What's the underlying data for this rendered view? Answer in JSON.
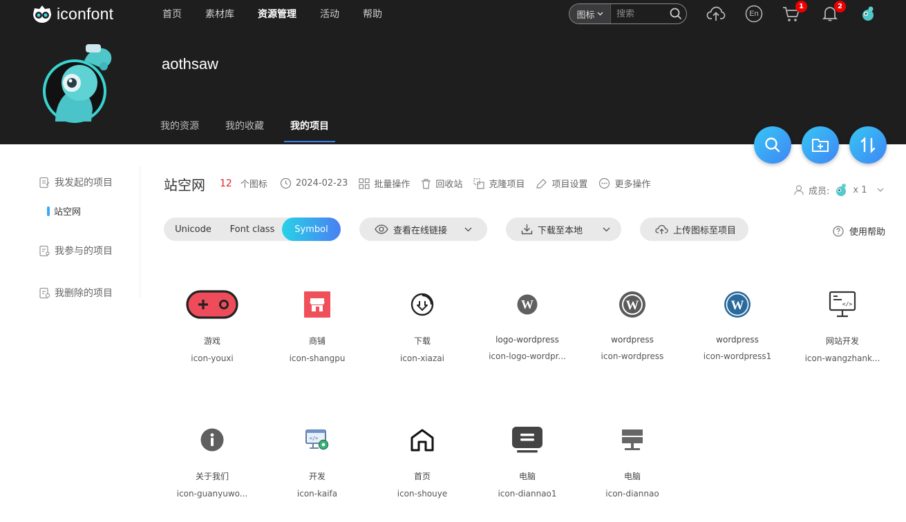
{
  "header": {
    "logo_text": "iconfont",
    "nav": [
      {
        "label": "首页",
        "active": false
      },
      {
        "label": "素材库",
        "active": false
      },
      {
        "label": "资源管理",
        "active": true
      },
      {
        "label": "活动",
        "active": false
      },
      {
        "label": "帮助",
        "active": false
      }
    ],
    "search": {
      "type_label": "图标",
      "placeholder": "搜索"
    },
    "cart_badge": "1",
    "notification_badge": "2",
    "lang_label": "En"
  },
  "profile": {
    "username": "aothsaw",
    "tabs": [
      {
        "label": "我的资源",
        "active": false
      },
      {
        "label": "我的收藏",
        "active": false
      },
      {
        "label": "我的项目",
        "active": true
      }
    ]
  },
  "sidebar": {
    "created_label": "我发起的项目",
    "created_projects": [
      "站空网"
    ],
    "joined_label": "我参与的项目",
    "deleted_label": "我删除的项目"
  },
  "project": {
    "name": "站空网",
    "icon_count": "12",
    "icon_count_suffix": "个图标",
    "date": "2024-02-23",
    "actions": [
      "批量操作",
      "回收站",
      "克隆项目",
      "项目设置",
      "更多操作"
    ],
    "members_label": "成员:",
    "members_count": "x 1"
  },
  "toolbar": {
    "segments": [
      {
        "label": "Unicode",
        "active": false
      },
      {
        "label": "Font class",
        "active": false
      },
      {
        "label": "Symbol",
        "active": true
      }
    ],
    "view_online": "查看在线链接",
    "download": "下载至本地",
    "upload": "上传图标至项目",
    "help": "使用帮助"
  },
  "icons": [
    {
      "name": "游戏",
      "code": "icon-youxi",
      "glyph": "gamepad"
    },
    {
      "name": "商铺",
      "code": "icon-shangpu",
      "glyph": "shop"
    },
    {
      "name": "下载",
      "code": "icon-xiazai",
      "glyph": "download"
    },
    {
      "name": "logo-wordpress",
      "code": "icon-logo-wordpr...",
      "glyph": "wordpress-gray"
    },
    {
      "name": "wordpress",
      "code": "icon-wordpress",
      "glyph": "wordpress-ring"
    },
    {
      "name": "wordpress",
      "code": "icon-wordpress1",
      "glyph": "wordpress-blue"
    },
    {
      "name": "网站开发",
      "code": "icon-wangzhank...",
      "glyph": "monitor-code"
    },
    {
      "name": "关于我们",
      "code": "icon-guanyuwo...",
      "glyph": "info"
    },
    {
      "name": "开发",
      "code": "icon-kaifa",
      "glyph": "dev-gear"
    },
    {
      "name": "首页",
      "code": "icon-shouye",
      "glyph": "home"
    },
    {
      "name": "电脑",
      "code": "icon-diannao1",
      "glyph": "computer-filled"
    },
    {
      "name": "电脑",
      "code": "icon-diannao",
      "glyph": "computer-gray"
    }
  ],
  "colors": {
    "header_bg": "#1e1e1f",
    "accent_gradient_start": "#27d2e8",
    "accent_gradient_end": "#4a7ff2",
    "count_red": "#e02020",
    "gamepad_red": "#ef4c5b",
    "shop_red": "#f0505a",
    "wordpress_blue": "#2a6a9c"
  }
}
